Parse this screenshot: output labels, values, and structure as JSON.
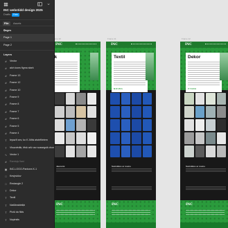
{
  "file": {
    "title": "INC webstidd design 2025",
    "drafts_label": "Drafts",
    "plan_badge": "Free"
  },
  "tabs": {
    "file": "File",
    "assets": "Assets"
  },
  "pages": {
    "heading": "Pages",
    "items": [
      {
        "label": "Page 1",
        "selected": true
      },
      {
        "label": "Page 2",
        "selected": false
      }
    ]
  },
  "layers": {
    "heading": "Layers",
    "items": [
      {
        "icon": "hash-icon",
        "label": "Vector"
      },
      {
        "icon": "hash-icon",
        "label": "alch icons figma stark"
      },
      {
        "icon": "hash-icon",
        "label": "Frame 13"
      },
      {
        "icon": "hash-icon",
        "label": "Frame 12"
      },
      {
        "icon": "hash-icon",
        "label": "Frame 10"
      },
      {
        "icon": "hash-icon",
        "label": "Frame 9"
      },
      {
        "icon": "hash-icon",
        "label": "Frame 8"
      },
      {
        "icon": "hash-icon",
        "label": "Frame 7"
      },
      {
        "icon": "hash-icon",
        "label": "Frame 6"
      },
      {
        "icon": "hash-icon",
        "label": "Frame 5"
      },
      {
        "icon": "hash-icon",
        "label": "Frame 4"
      },
      {
        "icon": "text-icon",
        "label": "Iepazīt sev, ko tī Jūtīsi atstrēiteiem"
      },
      {
        "icon": "text-icon",
        "label": "Visuzvtnāk, tēsk arīz arz sussegsik drums"
      },
      {
        "icon": "vector-icon",
        "label": "Vector 1"
      },
      {
        "icon": "hash-icon",
        "label": "Ramtojs flast",
        "dim": true
      },
      {
        "icon": "image-icon",
        "label": "INC-LOGO-Pantone-K-1"
      },
      {
        "icon": "rect-icon",
        "label": "Kesjrsiduv"
      },
      {
        "icon": "rect-icon",
        "label": "Rectangle 2"
      },
      {
        "icon": "text-icon",
        "label": "Dekor"
      },
      {
        "icon": "text-icon",
        "label": "Textil"
      },
      {
        "icon": "text-icon",
        "label": "Natūbrakteiķb"
      },
      {
        "icon": "text-icon",
        "label": "Pioši da filds"
      },
      {
        "icon": "text-icon",
        "label": "Nopirsits"
      }
    ]
  },
  "canvas": {
    "background": "#e5e5e5",
    "frames": [
      {
        "label": "Frame 10",
        "card_title": "Izdēk",
        "brand": "NOVRA",
        "tile_colors": [
          "#3b3b3b",
          "#d9d9d9",
          "#8a8a8a",
          "#eaeaea",
          "#cfcfcf",
          "#bdbdbd",
          "#d7c4a3",
          "#e0e0e0",
          "#dcdcdc",
          "#6fa0d0",
          "#b4b4b4",
          "#3a3a3a",
          "#e8e8e8",
          "#c8c8c8",
          "#dedede",
          "#f0f0f0",
          "#3d3d3d",
          "#e3e3e3",
          "#a5a5a5",
          "#e7e7e7"
        ],
        "section_title": "Jaunumi",
        "footer_logo": "INC"
      },
      {
        "label": "Frame 11",
        "card_title": "Textil",
        "brand": "NOVRA",
        "tile_colors": [
          "#1e4fae",
          "#2a5fc0",
          "#1c4aa6",
          "#2258b8",
          "#1e4fae",
          "#2a5fc0",
          "#1c4aa6",
          "#2258b8",
          "#1e4fae",
          "#2a5fc0",
          "#1c4aa6",
          "#2258b8",
          "#1e4fae",
          "#2a5fc0",
          "#1c4aa6",
          "#2258b8",
          "#1e4fae",
          "#2a5fc0",
          "#1c4aa6",
          "#2258b8"
        ],
        "section_title": "Sazināties ar mums",
        "footer_logo": "INC"
      },
      {
        "label": "Frame 12",
        "card_title": "Dekor",
        "brand": "VYANA",
        "tile_colors": [
          "#c9d6c2",
          "#e3e3e3",
          "#dfe6da",
          "#a8b4b0",
          "#cfd4cb",
          "#6aa0c8",
          "#9fb1b4",
          "#8b8b8b",
          "#e1e1e1",
          "#eeeeee",
          "#c7cfd2",
          "#2e2e2e",
          "#9c9c9c",
          "#c6c6c6",
          "#7a8a8c",
          "#e6e6e6",
          "#cdd3cf",
          "#5b5b5b",
          "#dadada",
          "#b9b9b9"
        ],
        "section_title": "Sazināties ar mums",
        "footer_logo": "INC"
      }
    ]
  }
}
